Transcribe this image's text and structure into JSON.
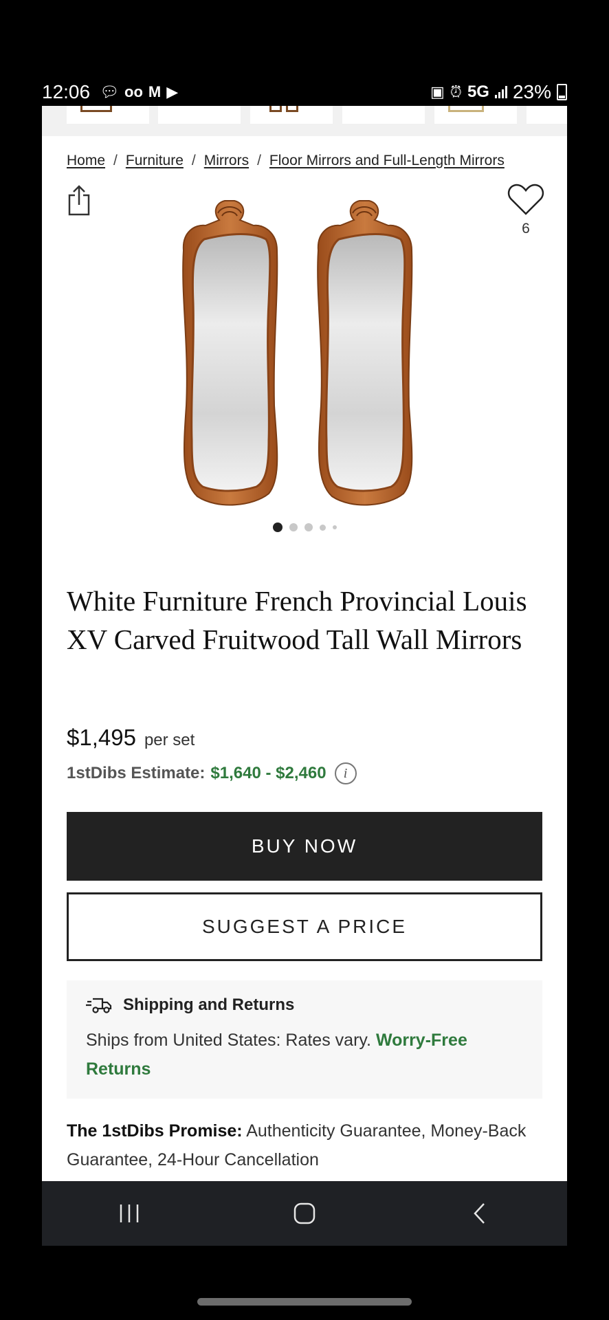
{
  "status_bar": {
    "time": "12:06",
    "network": "5G",
    "battery": "23%"
  },
  "breadcrumb": [
    {
      "label": "Home"
    },
    {
      "label": "Furniture"
    },
    {
      "label": "Mirrors"
    },
    {
      "label": "Floor Mirrors and Full-Length Mirrors"
    }
  ],
  "favorites": {
    "count": "6"
  },
  "gallery": {
    "total": 5,
    "active": 1
  },
  "product": {
    "title": "White Furniture French Provincial Louis XV Carved Fruitwood Tall Wall Mirrors",
    "price": "$1,495",
    "price_unit": "per set",
    "estimate_label": "1stDibs Estimate:",
    "estimate_range": "$1,640 - $2,460",
    "info_glyph": "i"
  },
  "actions": {
    "buy_now": "BUY NOW",
    "suggest_price": "SUGGEST A PRICE"
  },
  "shipping": {
    "title": "Shipping and Returns",
    "text": "Ships from United States: Rates vary.",
    "link": "Worry-Free Returns"
  },
  "promise": {
    "label": "The 1stDibs Promise:",
    "text": "Authenticity Guarantee, Money-Back Guarantee, 24-Hour Cancellation"
  },
  "colors": {
    "accent_green": "#2f7a3d",
    "primary_button": "#222222",
    "wood": "#b8652c"
  }
}
